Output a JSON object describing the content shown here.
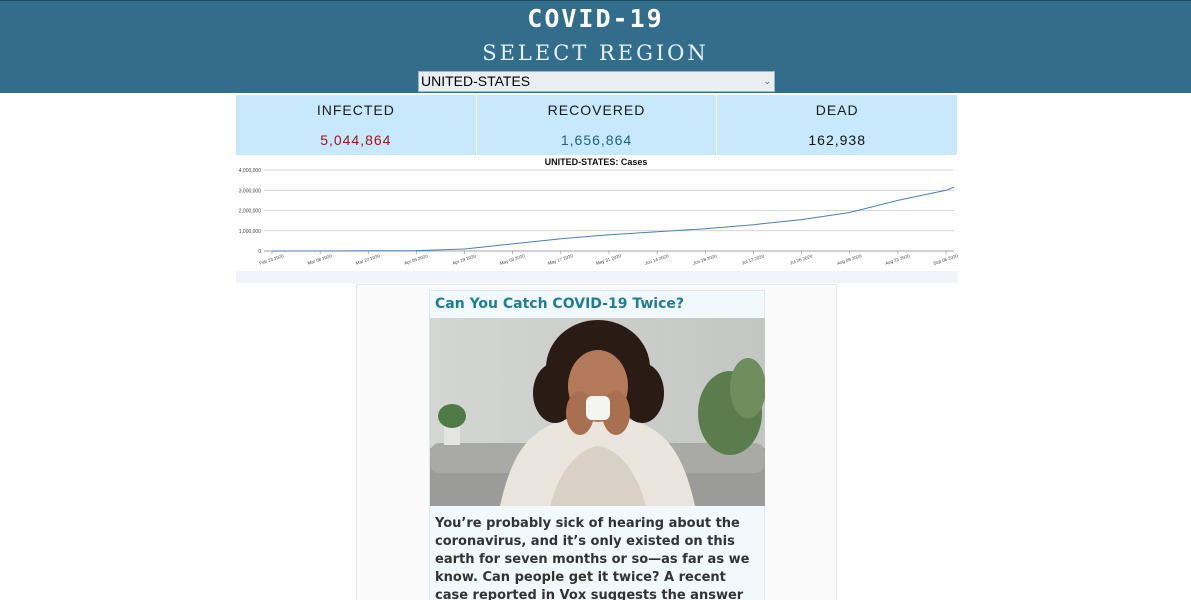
{
  "header": {
    "title": "COVID-19",
    "subtitle": "SELECT REGION",
    "region_selected": "UNITED-STATES"
  },
  "stats": {
    "infected": {
      "label": "INFECTED",
      "value": "5,044,864",
      "color": "#a31515"
    },
    "recovered": {
      "label": "RECOVERED",
      "value": "1,656,864",
      "color": "#1f5f86"
    },
    "dead": {
      "label": "DEAD",
      "value": "162,938",
      "color": "#111111"
    }
  },
  "chart_data": {
    "type": "line",
    "title": "UNITED-STATES: Cases",
    "xlabel": "",
    "ylabel": "",
    "ylim": [
      0,
      4000000
    ],
    "yticks": [
      "0",
      "1,000,000",
      "2,000,000",
      "3,000,000",
      "4,000,000"
    ],
    "xticks": [
      "Feb 23 2020",
      "Mar 08 2020",
      "Mar 22 2020",
      "Apr 05 2020",
      "Apr 19 2020",
      "May 03 2020",
      "May 17 2020",
      "May 31 2020",
      "Jun 14 2020",
      "Jun 28 2020",
      "Jul 12 2020",
      "Jul 26 2020",
      "Aug 09 2020",
      "Aug 23 2020",
      "Sep 06 2020"
    ],
    "grid": true,
    "series": [
      {
        "color": "#4a7fb5",
        "x": [
          "Feb 23 2020",
          "Mar 08 2020",
          "Mar 22 2020",
          "Apr 05 2020",
          "Apr 19 2020",
          "May 03 2020",
          "May 17 2020",
          "May 31 2020",
          "Jun 14 2020",
          "Jun 28 2020",
          "Jul 12 2020",
          "Jul 26 2020",
          "Aug 09 2020",
          "Aug 23 2020",
          "Sep 06 2020",
          "Sep 13 2020"
        ],
        "values": [
          0,
          0,
          10000,
          20000,
          100000,
          350000,
          600000,
          800000,
          950000,
          1100000,
          1300000,
          1550000,
          1900000,
          2500000,
          3000000,
          3150000
        ]
      }
    ]
  },
  "article": {
    "title": "Can You Catch COVID-19 Twice?",
    "image_alt": "woman-sneezing-photo",
    "text": "You’re probably sick of hearing about the coronavirus, and it’s only existed on this earth for seven months or so—as far as we know. Can people get it twice? A recent case reported in Vox suggests the answer may be yes, but there are too many"
  }
}
